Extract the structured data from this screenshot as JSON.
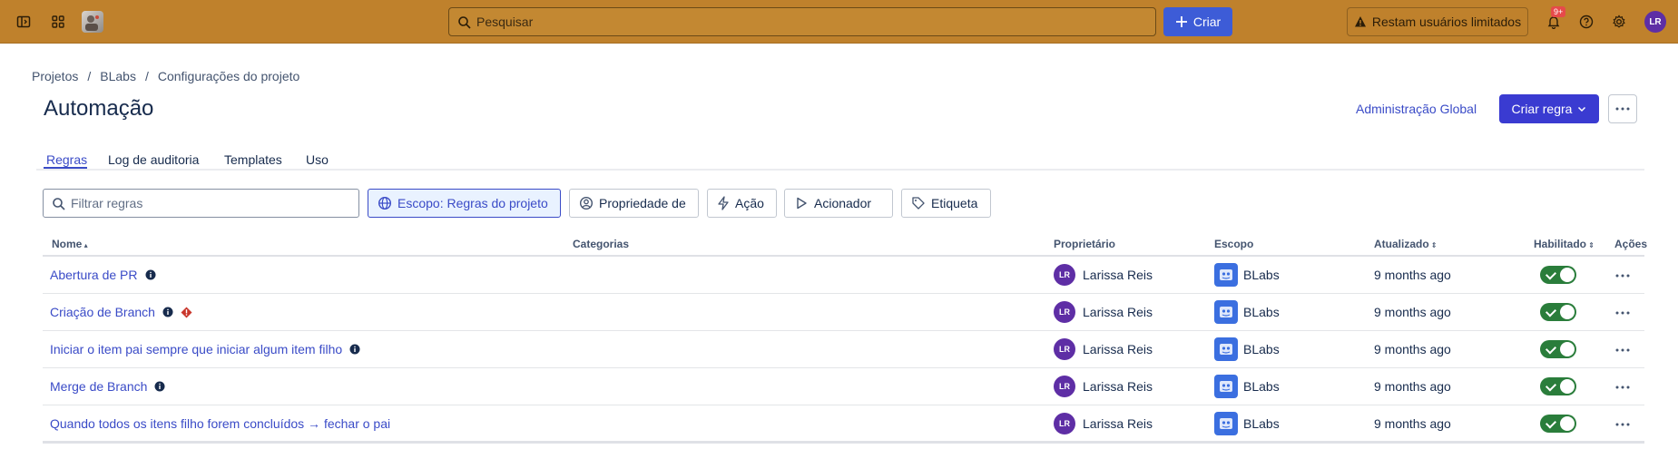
{
  "topbar": {
    "search_placeholder": "Pesquisar",
    "create_label": "Criar",
    "restam_label": "Restam usuários limitados",
    "notifications_badge": "9+",
    "user_initials": "LR"
  },
  "breadcrumb": [
    "Projetos",
    "BLabs",
    "Configurações do projeto"
  ],
  "page": {
    "title": "Automação",
    "admin_link": "Administração Global",
    "create_rule_label": "Criar regra"
  },
  "tabs": [
    "Regras",
    "Log de auditoria",
    "Templates",
    "Uso"
  ],
  "filters": {
    "search_placeholder": "Filtrar regras",
    "scope_chip": "Escopo: Regras do projeto",
    "property_chip": "Propriedade de",
    "action_chip": "Ação",
    "trigger_chip": "Acionador",
    "label_chip": "Etiqueta"
  },
  "table": {
    "headers": {
      "name": "Nome",
      "categories": "Categorias",
      "owner": "Proprietário",
      "scope": "Escopo",
      "updated": "Atualizado",
      "enabled": "Habilitado",
      "actions": "Ações"
    },
    "rows": [
      {
        "name": "Abertura de PR",
        "owner_initials": "LR",
        "owner": "Larissa Reis",
        "scope": "BLabs",
        "updated": "9 months ago",
        "enabled": true
      },
      {
        "name": "Criação de Branch",
        "owner_initials": "LR",
        "owner": "Larissa Reis",
        "scope": "BLabs",
        "updated": "9 months ago",
        "enabled": true
      },
      {
        "name": "Iniciar o item pai sempre que iniciar algum item filho",
        "owner_initials": "LR",
        "owner": "Larissa Reis",
        "scope": "BLabs",
        "updated": "9 months ago",
        "enabled": true
      },
      {
        "name": "Merge de Branch",
        "owner_initials": "LR",
        "owner": "Larissa Reis",
        "scope": "BLabs",
        "updated": "9 months ago",
        "enabled": true
      },
      {
        "name": "Quando todos os itens filho forem concluídos → fechar o pai",
        "owner_initials": "LR",
        "owner": "Larissa Reis",
        "scope": "BLabs",
        "updated": "9 months ago",
        "enabled": true
      }
    ]
  },
  "colors": {
    "topbar": "#bf812c",
    "primary": "#3a3bd1",
    "link": "#3a4bc7",
    "toggle_on": "#2a7d3b",
    "avatar": "#5e2ea5"
  }
}
